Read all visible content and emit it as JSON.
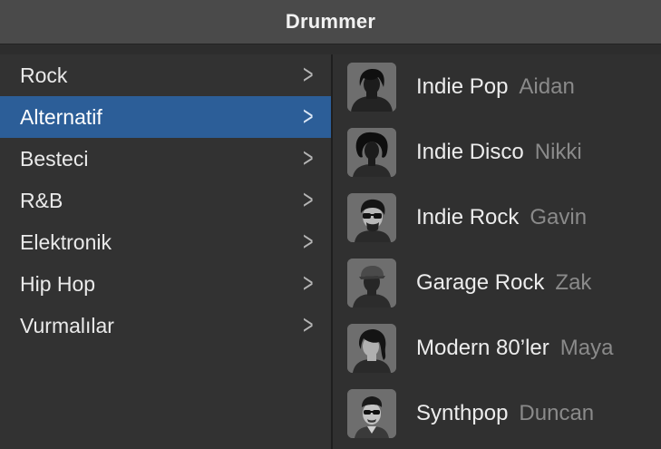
{
  "window": {
    "title": "Drummer"
  },
  "categories": [
    {
      "label": "Rock",
      "selected": false
    },
    {
      "label": "Alternatif",
      "selected": true
    },
    {
      "label": "Besteci",
      "selected": false
    },
    {
      "label": "R&B",
      "selected": false
    },
    {
      "label": "Elektronik",
      "selected": false
    },
    {
      "label": "Hip Hop",
      "selected": false
    },
    {
      "label": "Vurmalılar",
      "selected": false
    }
  ],
  "drummers": [
    {
      "genre": "Indie Pop",
      "name": "Aidan",
      "avatar_icon": "drummer-aidan-avatar-icon"
    },
    {
      "genre": "Indie Disco",
      "name": "Nikki",
      "avatar_icon": "drummer-nikki-avatar-icon"
    },
    {
      "genre": "Indie Rock",
      "name": "Gavin",
      "avatar_icon": "drummer-gavin-avatar-icon"
    },
    {
      "genre": "Garage Rock",
      "name": "Zak",
      "avatar_icon": "drummer-zak-avatar-icon"
    },
    {
      "genre": "Modern 80’ler",
      "name": "Maya",
      "avatar_icon": "drummer-maya-avatar-icon"
    },
    {
      "genre": "Synthpop",
      "name": "Duncan",
      "avatar_icon": "drummer-duncan-avatar-icon"
    }
  ],
  "colors": {
    "selection": "#2c5e98",
    "titlebar": "#4a4a4a",
    "panel": "#323232",
    "secondary_text": "#8a8a8a"
  }
}
